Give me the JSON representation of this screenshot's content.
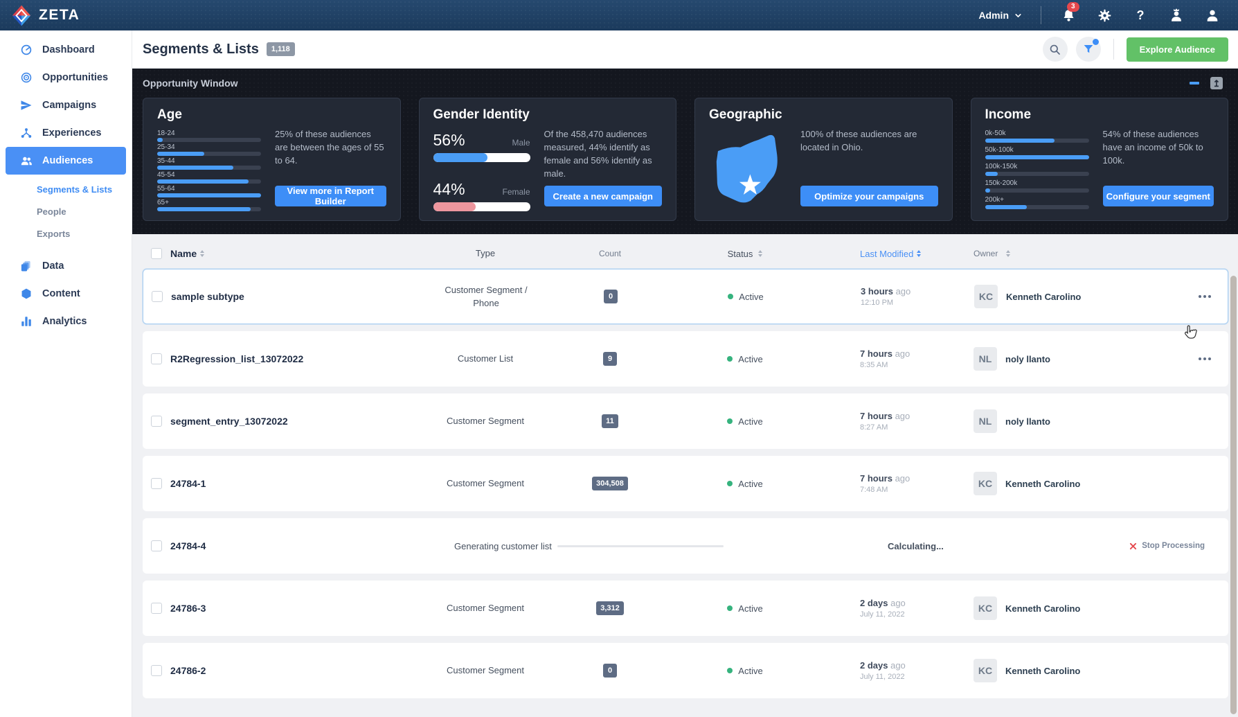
{
  "colors": {
    "accent": "#3d8ef7",
    "explore_green": "#62c167",
    "male_bar": "#4a9df6",
    "female_bar": "#ed969e",
    "status_active": "#36b37e",
    "alert_red": "#e5484d"
  },
  "navbar": {
    "brand": "ZETA",
    "admin_label": "Admin",
    "notification_count": "3",
    "help_glyph": "?"
  },
  "sidebar": {
    "items": [
      {
        "label": "Dashboard",
        "icon": "dashboard"
      },
      {
        "label": "Opportunities",
        "icon": "opportunities"
      },
      {
        "label": "Campaigns",
        "icon": "campaigns"
      },
      {
        "label": "Experiences",
        "icon": "experiences"
      },
      {
        "label": "Audiences",
        "icon": "audiences",
        "active": true,
        "children": [
          {
            "label": "Segments & Lists",
            "active": true
          },
          {
            "label": "People"
          },
          {
            "label": "Exports"
          }
        ]
      },
      {
        "label": "Data",
        "icon": "data"
      },
      {
        "label": "Content",
        "icon": "content"
      },
      {
        "label": "Analytics",
        "icon": "analytics"
      }
    ]
  },
  "header": {
    "title": "Segments & Lists",
    "count_badge": "1,118",
    "explore_button": "Explore Audience"
  },
  "opportunity": {
    "title": "Opportunity Window",
    "cards": [
      {
        "title": "Age",
        "bars": [
          {
            "label": "18-24",
            "value": 5
          },
          {
            "label": "25-34",
            "value": 45
          },
          {
            "label": "35-44",
            "value": 73
          },
          {
            "label": "45-54",
            "value": 88
          },
          {
            "label": "55-64",
            "value": 100
          },
          {
            "label": "65+",
            "value": 90
          }
        ],
        "description": "25% of these audiences are between the ages of 55 to 64.",
        "button": "View more in Report Builder"
      },
      {
        "title": "Gender Identity",
        "stats": [
          {
            "pct": "56%",
            "label": "Male",
            "value": 56
          },
          {
            "pct": "44%",
            "label": "Female",
            "value": 44
          }
        ],
        "description": "Of the 458,470 audiences measured, 44% identify as female and 56% identify as male.",
        "button": "Create a new campaign"
      },
      {
        "title": "Geographic",
        "map": "ohio-state",
        "description": "100% of these audiences are located in Ohio.",
        "button": "Optimize your campaigns"
      },
      {
        "title": "Income",
        "bars": [
          {
            "label": "0k-50k",
            "value": 67
          },
          {
            "label": "50k-100k",
            "value": 100
          },
          {
            "label": "100k-150k",
            "value": 12
          },
          {
            "label": "150k-200k",
            "value": 5
          },
          {
            "label": "200k+",
            "value": 40
          }
        ],
        "description": "54% of these audiences have an income of 50k to 100k.",
        "button": "Configure your segment"
      }
    ]
  },
  "table": {
    "columns": [
      {
        "label": "Name",
        "sortable": true
      },
      {
        "label": "Type",
        "sortable": false
      },
      {
        "label": "Count",
        "sortable": false
      },
      {
        "label": "Status",
        "sortable": true
      },
      {
        "label": "Last Modified",
        "sortable": true,
        "active": true
      },
      {
        "label": "Owner",
        "sortable": true
      }
    ],
    "rows": [
      {
        "name": "sample subtype",
        "type": [
          "Customer Segment /",
          "Phone"
        ],
        "count": "0",
        "status": "Active",
        "time": "3 hours",
        "time_suffix": "ago",
        "time_detail": "12:10 PM",
        "owner_initials": "KC",
        "owner": "Kenneth Carolino",
        "menu": true,
        "highlighted": true
      },
      {
        "name": "R2Regression_list_13072022",
        "type": [
          "Customer List"
        ],
        "count": "9",
        "status": "Active",
        "time": "7 hours",
        "time_suffix": "ago",
        "time_detail": "8:35 AM",
        "owner_initials": "NL",
        "owner": "noly llanto",
        "menu": true
      },
      {
        "name": "segment_entry_13072022",
        "type": [
          "Customer Segment"
        ],
        "count": "11",
        "status": "Active",
        "time": "7 hours",
        "time_suffix": "ago",
        "time_detail": "8:27 AM",
        "owner_initials": "NL",
        "owner": "noly llanto"
      },
      {
        "name": "24784-1",
        "type": [
          "Customer Segment"
        ],
        "count": "304,508",
        "status": "Active",
        "time": "7 hours",
        "time_suffix": "ago",
        "time_detail": "7:48 AM",
        "owner_initials": "KC",
        "owner": "Kenneth Carolino"
      },
      {
        "name": "24784-4",
        "processing": {
          "label": "Generating customer list",
          "status_text": "Calculating...",
          "action": "Stop Processing"
        }
      },
      {
        "name": "24786-3",
        "type": [
          "Customer Segment"
        ],
        "count": "3,312",
        "status": "Active",
        "time": "2 days",
        "time_suffix": "ago",
        "time_detail": "July 11, 2022",
        "owner_initials": "KC",
        "owner": "Kenneth Carolino"
      },
      {
        "name": "24786-2",
        "type": [
          "Customer Segment"
        ],
        "count": "0",
        "status": "Active",
        "time": "2 days",
        "time_suffix": "ago",
        "time_detail": "July 11, 2022",
        "owner_initials": "KC",
        "owner": "Kenneth Carolino"
      }
    ]
  }
}
